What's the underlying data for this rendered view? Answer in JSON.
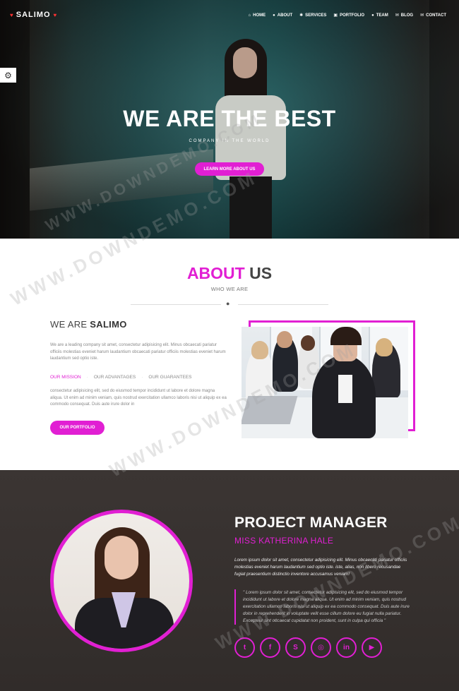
{
  "nav": {
    "brand": "SALIMO",
    "brand_icon": "heart-icon",
    "items": [
      {
        "label": "HOME",
        "icon": "home-icon",
        "glyph": "⌂"
      },
      {
        "label": "ABOUT",
        "icon": "user-icon",
        "glyph": "●"
      },
      {
        "label": "SERVICES",
        "icon": "gear-icon",
        "glyph": "✱"
      },
      {
        "label": "PORTFOLIO",
        "icon": "image-icon",
        "glyph": "▣"
      },
      {
        "label": "TEAM",
        "icon": "user-icon",
        "glyph": "●"
      },
      {
        "label": "BLOG",
        "icon": "comments-icon",
        "glyph": "✉"
      },
      {
        "label": "CONTACT",
        "icon": "envelope-icon",
        "glyph": "✉"
      }
    ]
  },
  "hero": {
    "title": "WE ARE THE BEST",
    "subtitle": "COMPANY IN THE WORLD",
    "button": "LEARN MORE ABOUT US"
  },
  "about": {
    "title_accent": "ABOUT",
    "title_rest": " US",
    "subtitle": "WHO WE ARE",
    "heading_light": "WE ARE ",
    "heading_bold": "SALIMO",
    "paragraph1": "We are a leading company sit amet, consectetur adipisicing elit. Minus obcaecati pariatur officiis molestias eveniet harum laudantium obcaecati pariatur officiis molestias eveniet harum laudantium sed optio iste.",
    "tabs": [
      "OUR MISSION",
      "OUR ADVANTAGES",
      "OUR GUARANTEES"
    ],
    "paragraph2": "consectetur adipisicing elit, sed do eiusmod tempor incididunt ut labore et dolore magna aliqua. Ut enim ad minim veniam, quis nostrud exercitation ullamco laboris nisi ut aliquip ex ea commodo consequat. Duis aute irure dolor in",
    "button": "OUR PORTFOLIO"
  },
  "manager": {
    "title": "PROJECT MANAGER",
    "name": "MISS KATHERINA HALE",
    "text": "Lorem ipsum dolor sit amet, consectetur adipisicing elit. Minus obcaecati pariatur officiis molestias eveniet harum laudantium sed optio iste. iste, alias, non libero recusandae fugiat praesentium distinctio inventore accusamus veniam!",
    "quote": "\" Lorem ipsum dolor sit amet, consectetur adipisicing elit, sed do eiusmod tempor incididunt ut labore et dolore magna aliqua. Ut enim ad minim veniam, quis nostrud exercitation ullamco laboris nisi ut aliquip ex ea commodo consequat. Duis aute irure dolor in reprehenderit in voluptate velit esse cillum dolore eu fugiat nulla pariatur. Excepteur sint occaecat cupidatat non proident, sunt in culpa qui officia \"",
    "socials": [
      {
        "name": "twitter-icon",
        "glyph": "t"
      },
      {
        "name": "facebook-icon",
        "glyph": "f"
      },
      {
        "name": "skype-icon",
        "glyph": "S"
      },
      {
        "name": "instagram-icon",
        "glyph": "◎"
      },
      {
        "name": "linkedin-icon",
        "glyph": "in"
      },
      {
        "name": "youtube-icon",
        "glyph": "▶"
      }
    ]
  },
  "watermark": "WWW.DOWNDEMO.COM",
  "colors": {
    "accent": "#e11fd3",
    "dark_section": "#342f2d",
    "hero_teal": "#1f4a4c"
  }
}
